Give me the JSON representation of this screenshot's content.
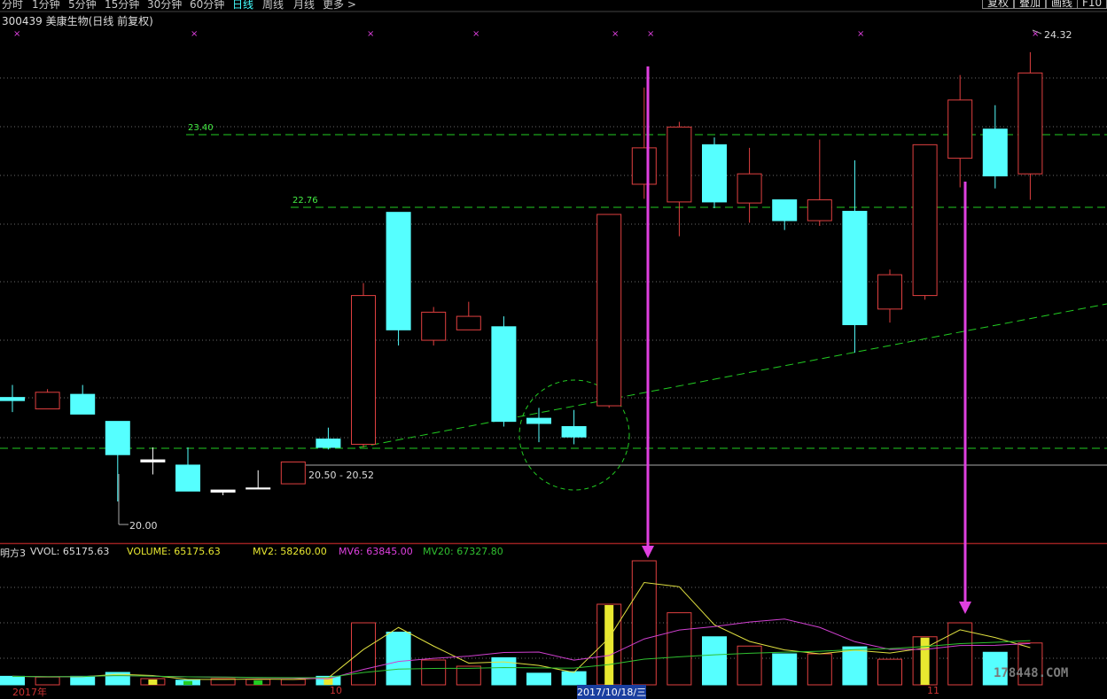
{
  "toolbar": {
    "periods": [
      "分时",
      "1分钟",
      "5分钟",
      "15分钟",
      "30分钟",
      "60分钟",
      "日线",
      "周线",
      "月线",
      "更多 >"
    ],
    "active_period": "日线",
    "buttons": [
      "复权",
      "叠加",
      "画线",
      "F10"
    ]
  },
  "stock": {
    "title": "300439 美康生物(日线 前复权)"
  },
  "price_labels": {
    "high": "24.32",
    "low": "20.00",
    "range": "20.50 - 20.52",
    "line1": "23.40",
    "line2": "22.76"
  },
  "indicator": {
    "name": "明方3",
    "vvol": "VVOL: 65175.63",
    "volume": "VOLUME: 65175.63",
    "mv2": "MV2: 58260.00",
    "mv6": "MV6: 63845.00",
    "mv20": "MV20: 67327.80"
  },
  "x_labels": {
    "start": "2017年",
    "m10": "10",
    "date": "2017/10/18/三",
    "m11": "11"
  },
  "watermark": "178448.COM",
  "colors": {
    "up": "#e04040",
    "down": "#55ffff",
    "ma_line": "#22cc22",
    "arrow": "#e040e0",
    "mv2": "#e0e040",
    "mv6": "#d040d0",
    "mv20": "#30c030"
  },
  "chart_data": {
    "type": "candlestick",
    "ylim": [
      19.6,
      24.6
    ],
    "candles": [
      {
        "o": 21.0,
        "c": 20.97,
        "h": 21.12,
        "l": 20.86
      },
      {
        "o": 20.89,
        "c": 21.05,
        "h": 21.08,
        "l": 20.89
      },
      {
        "o": 21.03,
        "c": 20.84,
        "h": 21.12,
        "l": 20.84
      },
      {
        "o": 20.77,
        "c": 20.45,
        "h": 20.77,
        "l": 20.0
      },
      {
        "o": 20.38,
        "c": 20.4,
        "h": 20.52,
        "l": 20.26
      },
      {
        "o": 20.35,
        "c": 20.1,
        "h": 20.52,
        "l": 20.1
      },
      {
        "o": 20.09,
        "c": 20.11,
        "h": 20.11,
        "l": 20.06
      },
      {
        "o": 20.12,
        "c": 20.13,
        "h": 20.3,
        "l": 20.12
      },
      {
        "o": 20.17,
        "c": 20.38,
        "h": 20.38,
        "l": 20.17
      },
      {
        "o": 20.6,
        "c": 20.52,
        "h": 20.71,
        "l": 20.5
      },
      {
        "o": 20.55,
        "c": 21.98,
        "h": 22.1,
        "l": 20.52
      },
      {
        "o": 22.78,
        "c": 21.65,
        "h": 22.78,
        "l": 21.5
      },
      {
        "o": 21.55,
        "c": 21.82,
        "h": 21.87,
        "l": 21.5
      },
      {
        "o": 21.65,
        "c": 21.78,
        "h": 21.92,
        "l": 21.65
      },
      {
        "o": 21.68,
        "c": 20.77,
        "h": 21.78,
        "l": 20.72
      },
      {
        "o": 20.8,
        "c": 20.75,
        "h": 20.9,
        "l": 20.57
      },
      {
        "o": 20.72,
        "c": 20.62,
        "h": 20.88,
        "l": 20.55
      },
      {
        "o": 20.92,
        "c": 22.76,
        "h": 22.76,
        "l": 20.9
      },
      {
        "o": 23.05,
        "c": 23.4,
        "h": 23.98,
        "l": 22.91
      },
      {
        "o": 22.88,
        "c": 23.6,
        "h": 23.65,
        "l": 22.55
      },
      {
        "o": 23.43,
        "c": 22.88,
        "h": 23.5,
        "l": 22.82
      },
      {
        "o": 22.87,
        "c": 23.15,
        "h": 23.4,
        "l": 22.68
      },
      {
        "o": 22.9,
        "c": 22.7,
        "h": 22.9,
        "l": 22.61
      },
      {
        "o": 22.7,
        "c": 22.9,
        "h": 23.48,
        "l": 22.65
      },
      {
        "o": 22.79,
        "c": 21.7,
        "h": 23.28,
        "l": 21.43
      },
      {
        "o": 21.85,
        "c": 22.18,
        "h": 22.23,
        "l": 21.72
      },
      {
        "o": 21.98,
        "c": 23.43,
        "h": 23.43,
        "l": 21.94
      },
      {
        "o": 23.3,
        "c": 23.86,
        "h": 24.1,
        "l": 23.02
      },
      {
        "o": 23.58,
        "c": 23.13,
        "h": 23.81,
        "l": 23.01
      },
      {
        "o": 23.15,
        "c": 24.12,
        "h": 24.32,
        "l": 22.9
      }
    ],
    "volume": {
      "max": 160000,
      "values": [
        11000,
        10000,
        11000,
        16000,
        8000,
        6000,
        8000,
        7000,
        7000,
        11000,
        80000,
        68000,
        32000,
        24000,
        35000,
        15000,
        17000,
        104000,
        160000,
        93000,
        62000,
        50000,
        40000,
        40000,
        49000,
        33000,
        62000,
        80000,
        42000,
        54000
      ],
      "highlight": [
        4,
        5,
        7,
        9,
        17,
        26
      ]
    }
  }
}
